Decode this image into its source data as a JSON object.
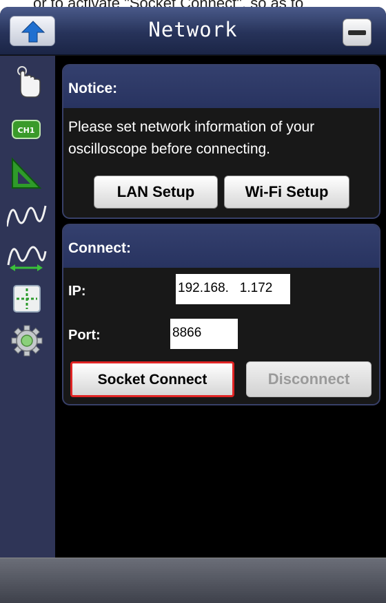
{
  "caption": "or to activate \"Socket Connect\", so as to",
  "window": {
    "title": "Network"
  },
  "toolbar": {
    "items": [
      {
        "icon": "touch-hand-icon"
      },
      {
        "icon": "channel-ch1-icon",
        "label": "CH1"
      },
      {
        "icon": "trigger-icon"
      },
      {
        "icon": "waveform-icon"
      },
      {
        "icon": "measure-waveform-icon"
      },
      {
        "icon": "cursor-icon"
      },
      {
        "icon": "gear-icon"
      }
    ]
  },
  "notice": {
    "title": "Notice:",
    "text_line1": "Please set network information of your",
    "text_line2": "oscilloscope before connecting.",
    "lan_setup_label": "LAN Setup",
    "wifi_setup_label": "Wi-Fi Setup"
  },
  "connect": {
    "title": "Connect:",
    "ip_label": "IP:",
    "ip_value": "192.168.   1.172",
    "port_label": "Port:",
    "port_value": "8866",
    "socket_connect_label": "Socket Connect",
    "disconnect_label": "Disconnect"
  },
  "colors": {
    "accent_highlight": "#e02424",
    "panel_header": "#2e3a68",
    "toolbar": "#2f3557"
  }
}
